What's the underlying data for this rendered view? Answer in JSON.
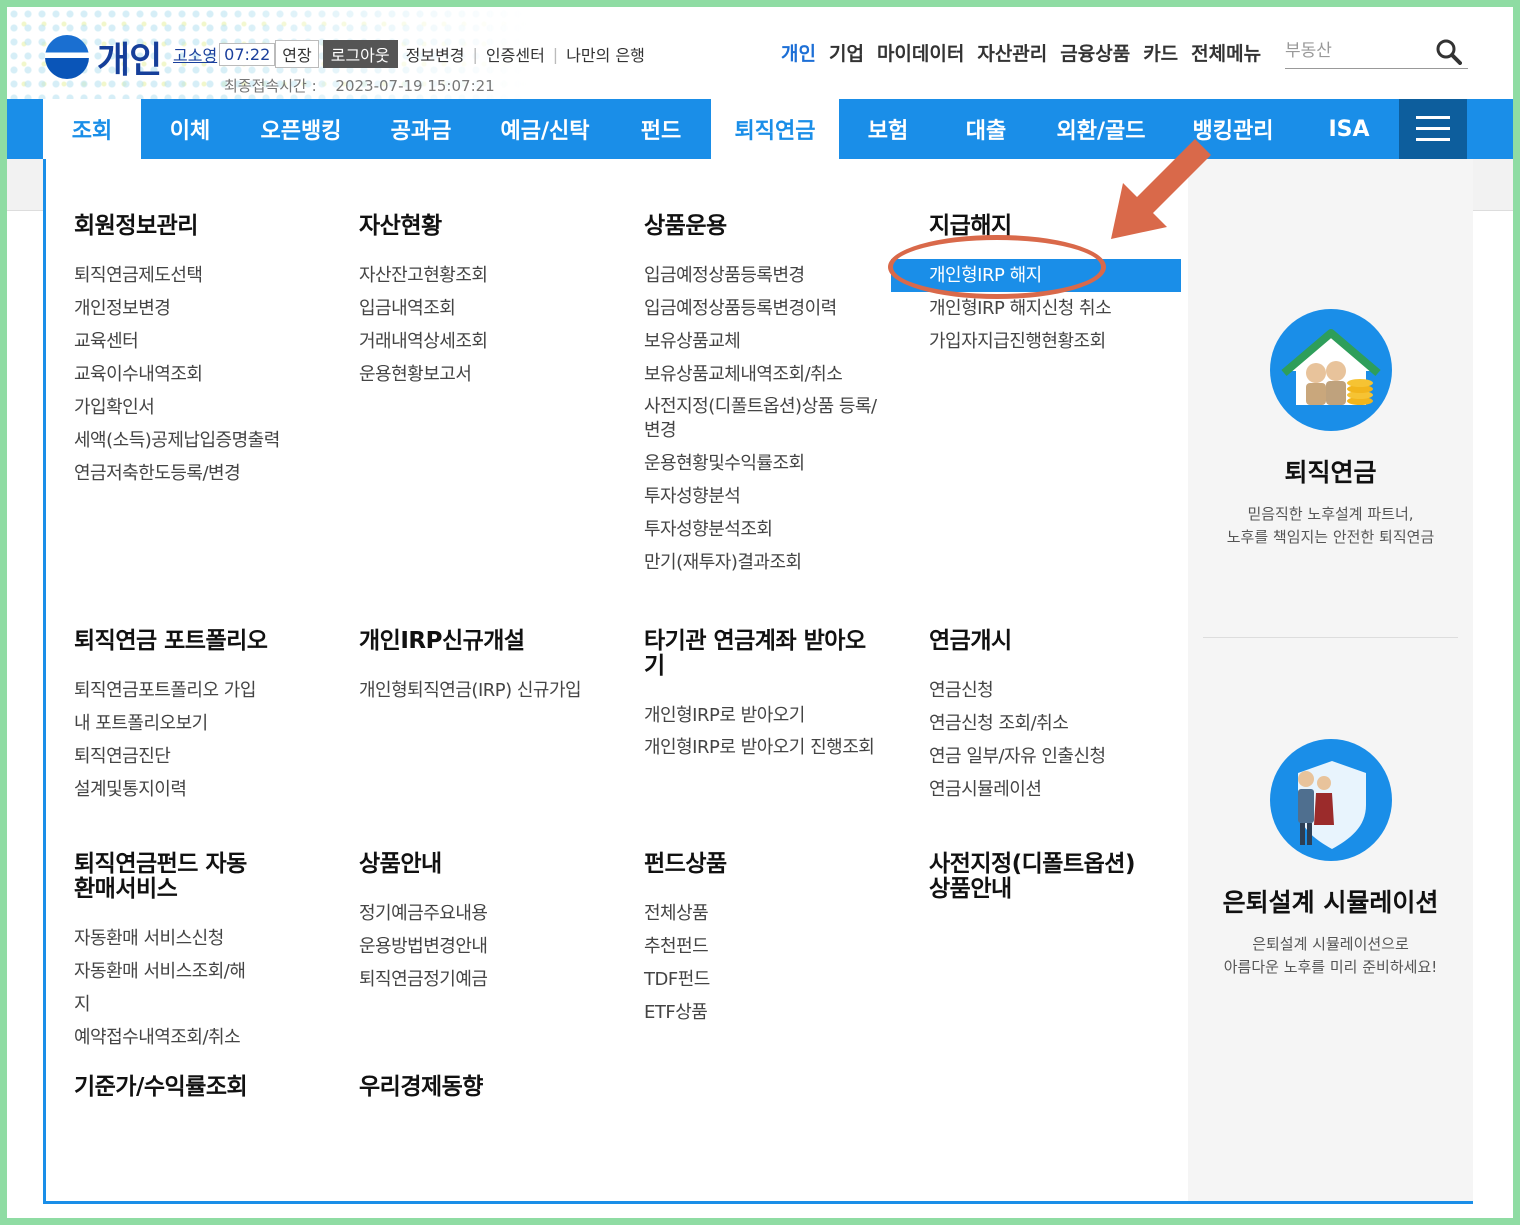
{
  "header": {
    "logo_text": "개인",
    "user_name": "고소영",
    "timer": "07:22",
    "extend_label": "연장",
    "logout_label": "로그아웃",
    "links": [
      "정보변경",
      "인증센터",
      "나만의 은행"
    ],
    "last_login_label": "최종접속시간 :",
    "last_login_value": "2023-07-19 15:07:21",
    "right_menu": [
      "개인",
      "기업",
      "마이데이터",
      "자산관리",
      "금융상품",
      "카드",
      "전체메뉴"
    ],
    "search_placeholder": "부동산"
  },
  "nav": {
    "items": [
      "조회",
      "이체",
      "오픈뱅킹",
      "공과금",
      "예금/신탁",
      "펀드",
      "퇴직연금",
      "보험",
      "대출",
      "외환/골드",
      "뱅킹관리",
      "ISA"
    ],
    "active": "퇴직연금"
  },
  "menu": {
    "g1": {
      "title": "회원정보관리",
      "items": [
        "퇴직연금제도선택",
        "개인정보변경",
        "교육센터",
        "교육이수내역조회",
        "가입확인서",
        "세액(소득)공제납입증명출력",
        "연금저축한도등록/변경"
      ]
    },
    "g2": {
      "title": "자산현황",
      "items": [
        "자산잔고현황조회",
        "입금내역조회",
        "거래내역상세조회",
        "운용현황보고서"
      ]
    },
    "g3": {
      "title": "상품운용",
      "items": [
        "입금예정상품등록변경",
        "입금예정상품등록변경이력",
        "보유상품교체",
        "보유상품교체내역조회/취소",
        "사전지정(디폴트옵션)상품 등록/변경",
        "운용현황및수익률조회",
        "투자성향분석",
        "투자성향분석조회",
        "만기(재투자)결과조회"
      ]
    },
    "g4": {
      "title": "지급해지",
      "items": [
        "개인형IRP 해지",
        "개인형IRP 해지신청 취소",
        "가입자지급진행현황조회"
      ]
    },
    "g5": {
      "title": "퇴직연금 포트폴리오",
      "items": [
        "퇴직연금포트폴리오 가입",
        "내 포트폴리오보기",
        "퇴직연금진단",
        "설계및통지이력"
      ]
    },
    "g6": {
      "title": "개인IRP신규개설",
      "items": [
        "개인형퇴직연금(IRP) 신규가입"
      ]
    },
    "g7": {
      "title": "타기관 연금계좌 받아오기",
      "items": [
        "개인형IRP로 받아오기",
        "개인형IRP로 받아오기 진행조회"
      ]
    },
    "g8": {
      "title": "연금개시",
      "items": [
        "연금신청",
        "연금신청 조회/취소",
        "연금 일부/자유 인출신청",
        "연금시뮬레이션"
      ]
    },
    "g9": {
      "title": "퇴직연금펀드 자동환매서비스",
      "items": [
        "자동환매 서비스신청",
        "자동환매 서비스조회/해지",
        "예약접수내역조회/취소"
      ]
    },
    "g10": {
      "title": "상품안내",
      "items": [
        "정기예금주요내용",
        "운용방법변경안내",
        "퇴직연금정기예금"
      ]
    },
    "g11": {
      "title": "펀드상품",
      "items": [
        "전체상품",
        "추천펀드",
        "TDF펀드",
        "ETF상품"
      ]
    },
    "g12": {
      "title": "사전지정(디폴트옵션) 상품안내",
      "items": []
    },
    "g13": {
      "title": "기준가/수익률조회",
      "items": []
    },
    "g14": {
      "title": "우리경제동향",
      "items": []
    }
  },
  "side": {
    "card1": {
      "title": "퇴직연금",
      "line1": "믿음직한 노후설계 파트너,",
      "line2": "노후를 책임지는 안전한 퇴직연금"
    },
    "card2": {
      "title": "은퇴설계 시뮬레이션",
      "line1": "은퇴설계 시뮬레이션으로",
      "line2": "아름다운 노후를 미리 준비하세요!"
    }
  },
  "colors": {
    "accent": "#1a8ee8",
    "annotation": "#d9694a",
    "frame": "#8fdca3"
  }
}
